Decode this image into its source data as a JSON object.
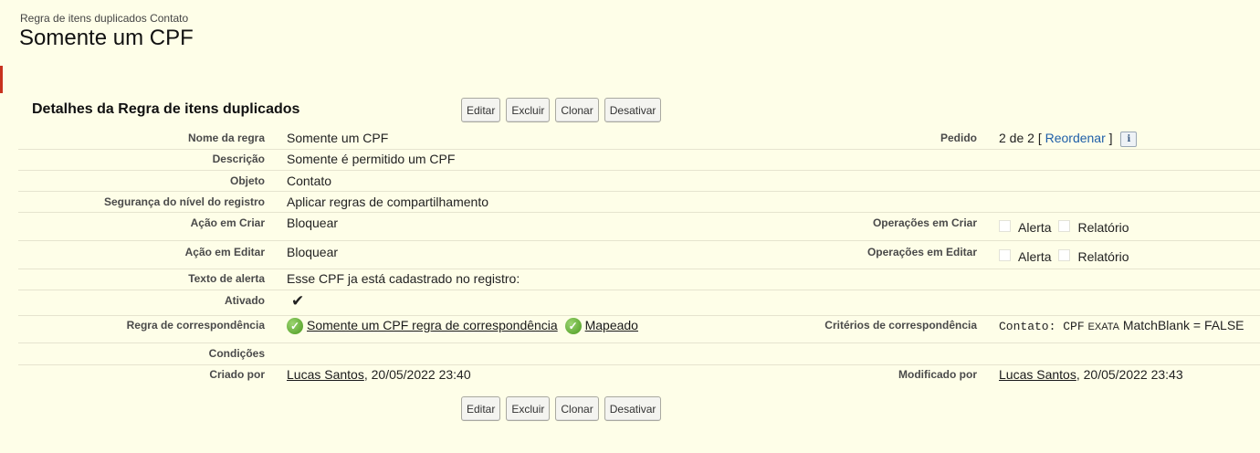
{
  "header": {
    "page_type": "Regra de itens duplicados Contato",
    "title": "Somente um CPF"
  },
  "section": {
    "title": "Detalhes da Regra de itens duplicados"
  },
  "buttons": {
    "edit": "Editar",
    "delete": "Excluir",
    "clone": "Clonar",
    "deactivate": "Desativar"
  },
  "fields": {
    "rule_name": {
      "label": "Nome da regra",
      "value": "Somente um CPF"
    },
    "order": {
      "label": "Pedido",
      "value": "2 de 2 [",
      "link": "Reordenar",
      "suffix": "]"
    },
    "description": {
      "label": "Descrição",
      "value": "Somente é permitido um CPF"
    },
    "object": {
      "label": "Objeto",
      "value": "Contato"
    },
    "security": {
      "label": "Segurança do nível do registro",
      "value": "Aplicar regras de compartilhamento"
    },
    "action_create": {
      "label": "Ação em Criar",
      "value": "Bloquear"
    },
    "ops_create": {
      "label": "Operações em Criar",
      "alert": "Alerta",
      "report": "Relatório"
    },
    "action_edit": {
      "label": "Ação em Editar",
      "value": "Bloquear"
    },
    "ops_edit": {
      "label": "Operações em Editar",
      "alert": "Alerta",
      "report": "Relatório"
    },
    "alert_text": {
      "label": "Texto de alerta",
      "value": "Esse CPF ja está cadastrado no registro:"
    },
    "active": {
      "label": "Ativado",
      "checkmark": "✔"
    },
    "matching_rule": {
      "label": "Regra de correspondência",
      "rule_link": "Somente um CPF regra de correspondência",
      "mapped_link": "Mapeado"
    },
    "matching_criteria": {
      "label": "Critérios de correspondência",
      "object": "Contato: CPF",
      "operator": "EXATA",
      "rest": "MatchBlank = FALSE"
    },
    "conditions": {
      "label": "Condições",
      "value": ""
    },
    "created_by": {
      "label": "Criado por",
      "user": "Lucas Santos",
      "date": ", 20/05/2022 23:40"
    },
    "modified_by": {
      "label": "Modificado por",
      "user": "Lucas Santos",
      "date": ", 20/05/2022 23:43"
    }
  }
}
